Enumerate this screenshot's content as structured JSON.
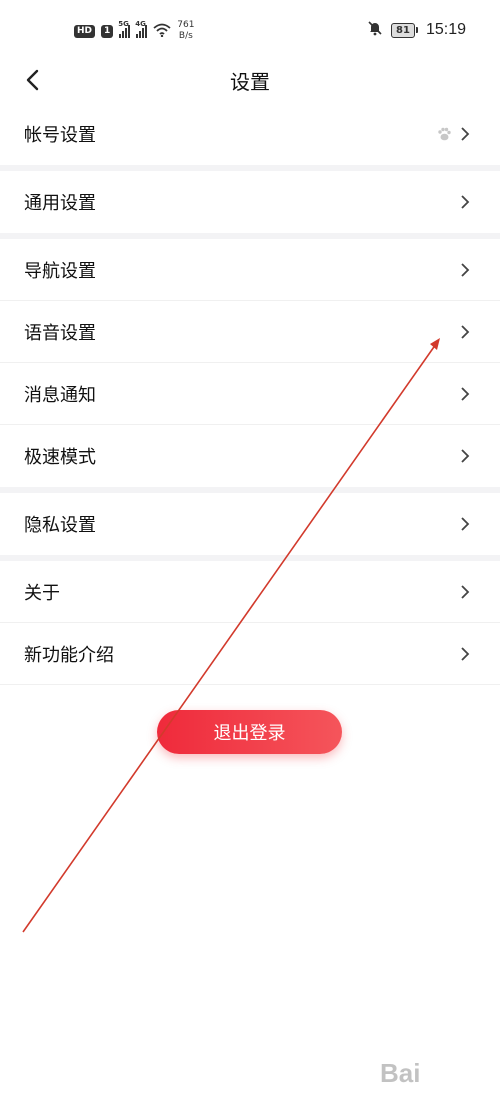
{
  "status_bar": {
    "hd_label": "HD",
    "sim1_label": "1",
    "net1": "5G",
    "net2": "4G",
    "speed_value": "761",
    "speed_unit": "B/s",
    "battery": "81",
    "time": "15:19"
  },
  "header": {
    "title": "设置"
  },
  "menu": {
    "groups": [
      {
        "items": [
          {
            "label": "帐号设置"
          }
        ]
      },
      {
        "items": [
          {
            "label": "通用设置"
          }
        ]
      },
      {
        "items": [
          {
            "label": "导航设置"
          },
          {
            "label": "语音设置"
          },
          {
            "label": "消息通知"
          },
          {
            "label": "极速模式"
          }
        ]
      },
      {
        "items": [
          {
            "label": "隐私设置"
          }
        ]
      },
      {
        "items": [
          {
            "label": "关于"
          },
          {
            "label": "新功能介绍"
          }
        ]
      }
    ]
  },
  "logout": {
    "label": "退出登录"
  },
  "watermark": {
    "text": "Bai"
  },
  "colors": {
    "accent": "#ef2a3b",
    "annotation_arrow": "#d23a2c"
  },
  "icons": {
    "back": "chevron-left-icon",
    "row_arrow": "chevron-right-icon",
    "account_badge": "paw-icon",
    "mute": "bell-off-icon",
    "wifi": "wifi-icon"
  }
}
